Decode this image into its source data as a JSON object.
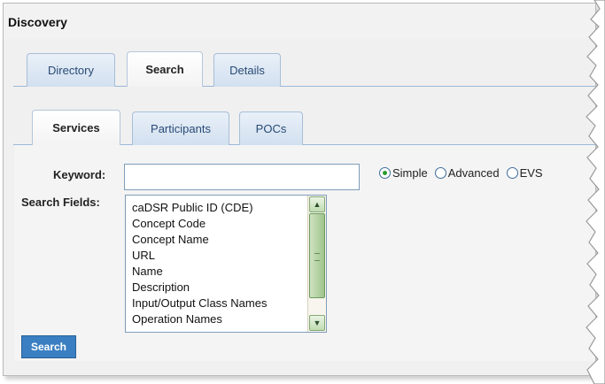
{
  "window": {
    "title": "Discovery"
  },
  "tabs_primary": [
    {
      "label": "Directory",
      "active": false
    },
    {
      "label": "Search",
      "active": true
    },
    {
      "label": "Details",
      "active": false
    }
  ],
  "tabs_secondary": [
    {
      "label": "Services",
      "active": true
    },
    {
      "label": "Participants",
      "active": false
    },
    {
      "label": "POCs",
      "active": false
    }
  ],
  "form": {
    "keyword_label": "Keyword:",
    "keyword_value": "",
    "search_fields_label": "Search Fields:",
    "search_modes": [
      {
        "label": "Simple",
        "selected": true
      },
      {
        "label": "Advanced",
        "selected": false
      },
      {
        "label": "EVS",
        "selected": false
      }
    ],
    "search_fields": [
      "caDSR Public ID (CDE)",
      "Concept Code",
      "Concept Name",
      "URL",
      "Name",
      "Description",
      "Input/Output Class Names",
      "Operation Names"
    ],
    "search_button": "Search"
  },
  "colors": {
    "tab_text": "#284a75",
    "button_bg": "#3a7fc2",
    "radio_selected": "#2c9a2c"
  }
}
